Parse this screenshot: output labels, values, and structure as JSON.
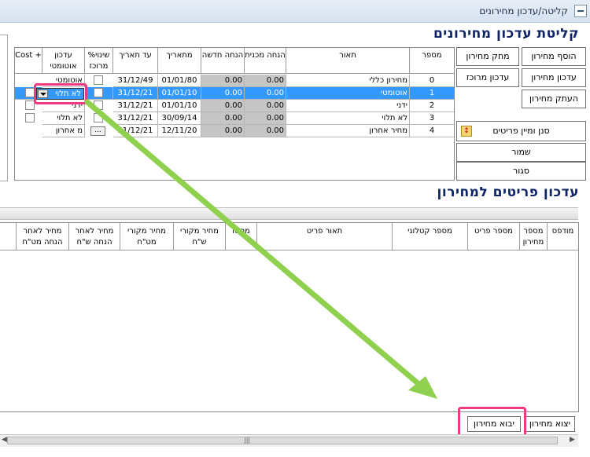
{
  "window": {
    "title": "קליטה/עדכון מחירונים"
  },
  "top_section": {
    "title": "קליטת עדכון מחירונים",
    "buttons": {
      "add": "הוסף מחירון",
      "delete": "מחק מחירון",
      "update": "עדכון מחירון",
      "central_update": "עדכון מרוכז",
      "copy": "העתק מחירון",
      "filter_sort": "סנן ומיין פריטים",
      "save": "שמור",
      "close": "סגור"
    },
    "table": {
      "headers": {
        "number": "מספר",
        "description": "תאור",
        "system_discount": "הנחה מכנית",
        "new_discount": "הנחה חדשה",
        "from_date": "מתאריך",
        "to_date": "עד תאריך",
        "central_change": "שינוי% מרוכז",
        "auto_update": "עדכון אוטומטי",
        "cost": "Cost +"
      },
      "rows": [
        {
          "number": "0",
          "description": "מחירון כללי",
          "system_discount": "0.00",
          "new_discount": "0.00",
          "from_date": "01/01/80",
          "to_date": "31/12/49",
          "auto_update": "אוטומטי"
        },
        {
          "number": "1",
          "description": "אוטומטי",
          "system_discount": "0.00",
          "new_discount": "0.00",
          "from_date": "01/01/10",
          "to_date": "31/12/21",
          "auto_update": "לא תלוי"
        },
        {
          "number": "2",
          "description": "ידני",
          "system_discount": "0.00",
          "new_discount": "0.00",
          "from_date": "01/01/10",
          "to_date": "31/12/21",
          "auto_update": "ידני"
        },
        {
          "number": "3",
          "description": "לא תלוי",
          "system_discount": "0.00",
          "new_discount": "0.00",
          "from_date": "30/09/14",
          "to_date": "31/12/21",
          "auto_update": "לא תלוי"
        },
        {
          "number": "4",
          "description": "מחיר אחרון",
          "system_discount": "0.00",
          "new_discount": "0.00",
          "from_date": "12/11/20",
          "to_date": "31/12/21",
          "auto_update": "מ אחרון",
          "ellipsis": "..."
        }
      ]
    }
  },
  "bottom_section": {
    "title": "עדכון פריטים למחירון",
    "headers": {
      "modified": "מודפס",
      "pricelist_number": "מספר מחירון",
      "item_number": "מספר פריט",
      "catalog_number": "מספר קטלוגי",
      "item_description": "תאור פריט",
      "status": "מסטו",
      "orig_price_nis": "מחיר מקורי ש\"ח",
      "orig_price_vat": "מחיר מקורי מט\"ח",
      "price_after_discount_nis": "מחיר לאחר הנחה ש\"ח",
      "price_after_discount_vat": "מחיר לאחר הנחה מט\"ח"
    },
    "buttons": {
      "export": "יצוא מחירון",
      "import": "יבוא מחירון"
    }
  },
  "annotation": {
    "arrow_color": "#8fd14f",
    "highlight_color": "#ee3a7f"
  }
}
